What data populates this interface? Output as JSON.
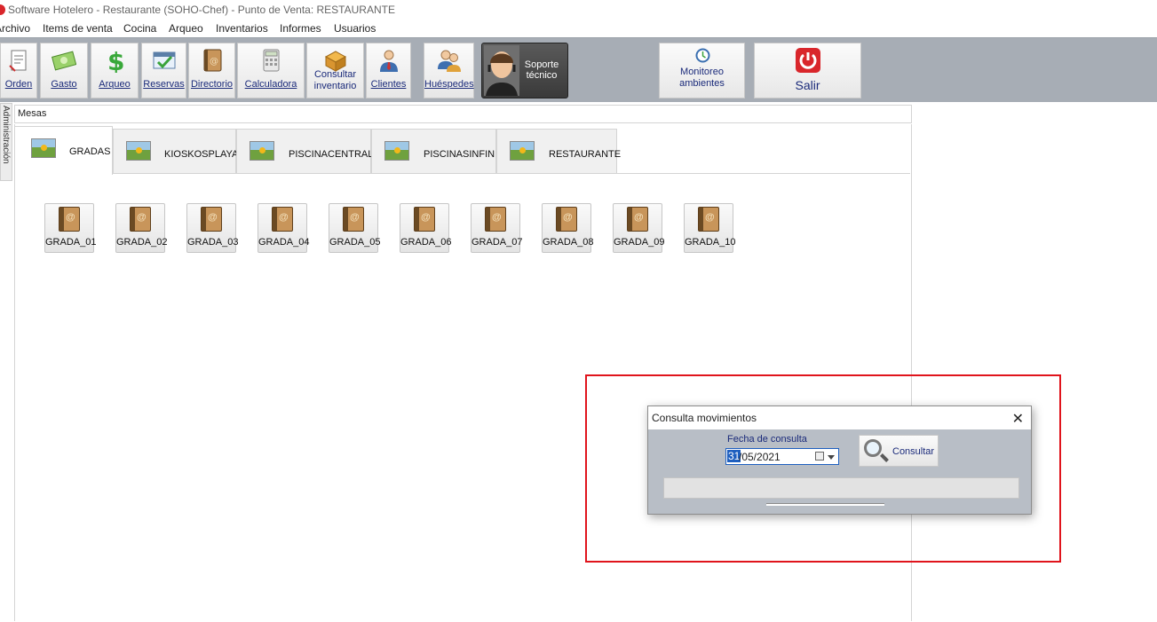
{
  "window": {
    "title": "Software  Hotelero - Restaurante (SOHO-Chef)  - Punto de Venta: RESTAURANTE"
  },
  "menu": [
    "Archivo",
    "Items de venta",
    "Cocina",
    "Arqueo",
    "Inventarios",
    "Informes",
    "Usuarios"
  ],
  "toolbar": {
    "orden": "Orden",
    "gasto": "Gasto",
    "arqueo": "Arqueo",
    "reservas": "Reservas",
    "directorio": "Directorio",
    "calculadora": "Calculadora",
    "consultar_inventario": "Consultar inventario",
    "clientes": "Clientes",
    "huespedes": "Huéspedes",
    "soporte": "Soporte técnico",
    "monitoreo": "Monitoreo ambientes",
    "salir": "Salir"
  },
  "left_strip_label": "Administración",
  "mesas": {
    "label": "Mesas",
    "tabs": [
      "GRADAS",
      "KIOSKOSPLAYA",
      "PISCINACENTRAL",
      "PISCINASINFIN",
      "RESTAURANTE"
    ],
    "active_tab": "GRADAS",
    "tables": [
      "GRADA_01",
      "GRADA_02",
      "GRADA_03",
      "GRADA_04",
      "GRADA_05",
      "GRADA_06",
      "GRADA_07",
      "GRADA_08",
      "GRADA_09",
      "GRADA_10"
    ]
  },
  "dialog": {
    "title": "Consulta movimientos",
    "close": "✕",
    "fecha_label": "Fecha de consulta",
    "date_selected": "31",
    "date_rest": "/05/2021",
    "consultar": "Consultar"
  },
  "colors": {
    "toolbar_bg": "#a7adb5",
    "dialog_bg": "#b8bec6",
    "highlight": "#e0141c",
    "link_text": "#1a2a7a"
  }
}
